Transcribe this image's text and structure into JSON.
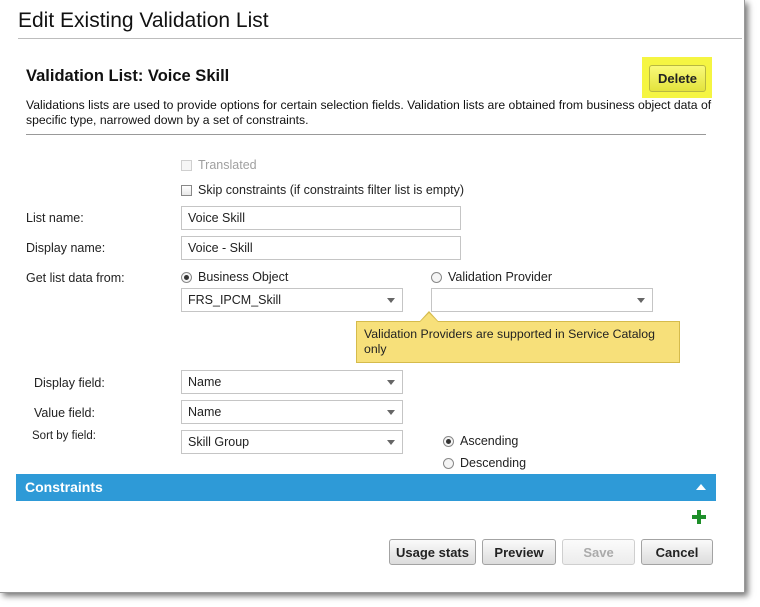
{
  "dialog": {
    "title": "Edit Existing Validation List"
  },
  "heading": {
    "title": "Validation List: Voice Skill",
    "delete_label": "Delete"
  },
  "description": "Validations lists are used to provide options for certain selection fields. Validation lists are obtained from business object data of specific type, narrowed down by a set of constraints.",
  "checkboxes": {
    "translated": {
      "label": "Translated",
      "checked": false,
      "disabled": true
    },
    "skip_constraints": {
      "label": "Skip constraints (if constraints filter list is empty)",
      "checked": false
    }
  },
  "fields": {
    "list_name": {
      "label": "List name:",
      "value": "Voice Skill"
    },
    "display_name": {
      "label": "Display name:",
      "value": "Voice - Skill"
    }
  },
  "source": {
    "label": "Get list data from:",
    "business_object": {
      "label": "Business Object",
      "selected": true,
      "value": "FRS_IPCM_Skill"
    },
    "validation_provider": {
      "label": "Validation Provider",
      "selected": false,
      "value": ""
    },
    "tooltip": "Validation Providers are supported in Service Catalog only"
  },
  "mapping": {
    "display_field": {
      "label": "Display field:",
      "value": "Name"
    },
    "value_field": {
      "label": "Value field:",
      "value": "Name"
    },
    "sort_by_field": {
      "label": "Sort by field:",
      "value": "Skill Group"
    },
    "ascending": {
      "label": "Ascending",
      "selected": true
    },
    "descending": {
      "label": "Descending",
      "selected": false
    }
  },
  "constraints": {
    "title": "Constraints"
  },
  "icons": {
    "add": "plus-icon",
    "collapse": "chevron-up-icon",
    "dropdown": "chevron-down-icon"
  },
  "colors": {
    "accent_bar": "#2e9ad7",
    "highlight": "#f5f542",
    "tooltip_bg": "#f7e07a",
    "add_icon": "#1e8f2a"
  },
  "footer": {
    "usage_stats_label": "Usage stats",
    "preview_label": "Preview",
    "save_label": "Save",
    "cancel_label": "Cancel"
  }
}
